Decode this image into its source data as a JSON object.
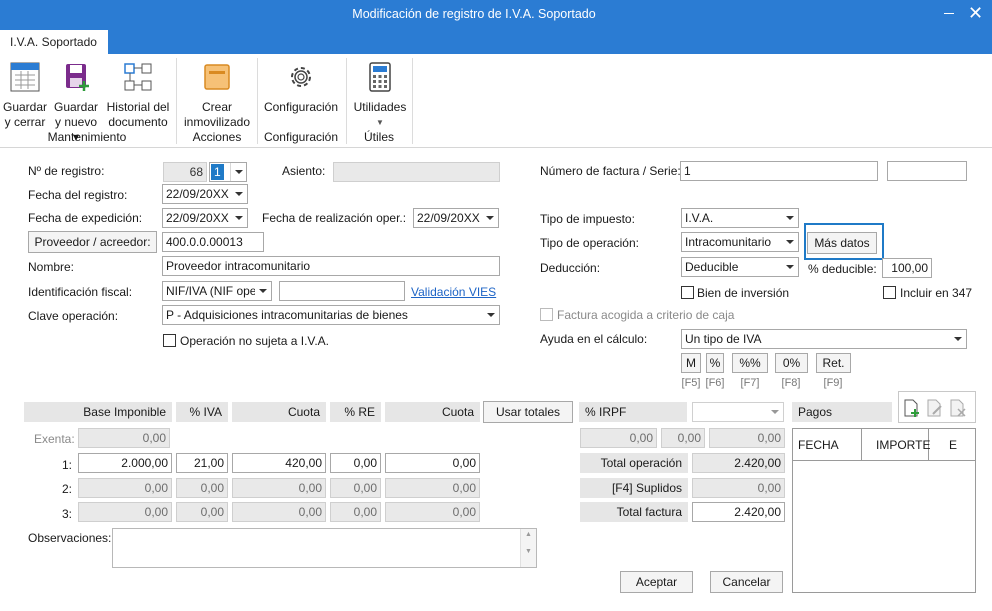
{
  "window": {
    "title": "Modificación de registro de I.V.A. Soportado"
  },
  "tab": {
    "label": "I.V.A. Soportado"
  },
  "ribbon": {
    "guardar_cerrar": [
      "Guardar",
      "y cerrar"
    ],
    "guardar_nuevo": [
      "Guardar",
      "y nuevo ▾"
    ],
    "historial": [
      "Historial del",
      "documento"
    ],
    "crear_inmovilizado": [
      "Crear",
      "inmovilizado"
    ],
    "configuracion": "Configuración",
    "utilidades": "Utilidades",
    "groups": {
      "mantenimiento": "Mantenimiento",
      "acciones": "Acciones",
      "configuracion": "Configuración",
      "utiles": "Útiles"
    }
  },
  "form": {
    "n_registro_label": "Nº de registro:",
    "n_registro_value": "68",
    "n_registro_serie": "1",
    "asiento_label": "Asiento:",
    "fecha_registro_label": "Fecha del registro:",
    "fecha_registro": "22/09/20XX",
    "fecha_expedicion_label": "Fecha de expedición:",
    "fecha_expedicion": "22/09/20XX",
    "fecha_realizacion_label": "Fecha de realización oper.:",
    "fecha_realizacion": "22/09/20XX",
    "proveedor_button": "Proveedor / acreedor:",
    "proveedor_value": "400.0.0.00013",
    "nombre_label": "Nombre:",
    "nombre_value": "Proveedor intracomunitario",
    "identificacion_label": "Identificación fiscal:",
    "identificacion_value": "NIF/IVA (NIF oper",
    "validacion_vies": "Validación VIES",
    "clave_label": "Clave operación:",
    "clave_value": "P - Adquisiciones intracomunitarias de bienes",
    "no_sujeta_label": "Operación no sujeta a I.V.A.",
    "numero_factura_label": "Número de factura / Serie:",
    "numero_factura": "1",
    "tipo_impuesto_label": "Tipo de impuesto:",
    "tipo_impuesto": "I.V.A.",
    "tipo_operacion_label": "Tipo de operación:",
    "tipo_operacion": "Intracomunitario",
    "mas_datos": "Más datos",
    "deduccion_label": "Deducción:",
    "deduccion": "Deducible",
    "pct_deducible_label": "% deducible:",
    "pct_deducible": "100,00",
    "bien_inversion": "Bien de inversión",
    "incluir_347": "Incluir en 347",
    "criterio_caja": "Factura acogida a criterio de caja",
    "ayuda_label": "Ayuda en el cálculo:",
    "ayuda_value": "Un tipo de IVA",
    "calc_buttons": [
      "M",
      "%",
      "%%",
      "0%",
      "Ret."
    ],
    "calc_keys": [
      "[F5]",
      "[F6]",
      "[F7]",
      "[F8]",
      "[F9]"
    ]
  },
  "grid": {
    "headers": {
      "base": "Base Imponible",
      "iva": "% IVA",
      "cuota": "Cuota",
      "re": "% RE",
      "cuota2": "Cuota",
      "usar_totales": "Usar totales",
      "irpf": "% IRPF"
    },
    "exenta_label": "Exenta:",
    "exenta_value": "0,00",
    "rows": [
      {
        "label": "1:",
        "base": "2.000,00",
        "iva": "21,00",
        "cuota": "420,00",
        "re": "0,00",
        "cuota2": "0,00"
      },
      {
        "label": "2:",
        "base": "0,00",
        "iva": "0,00",
        "cuota": "0,00",
        "re": "0,00",
        "cuota2": "0,00"
      },
      {
        "label": "3:",
        "base": "0,00",
        "iva": "0,00",
        "cuota": "0,00",
        "re": "0,00",
        "cuota2": "0,00"
      }
    ],
    "irpf_values": [
      "0,00",
      "0,00",
      "0,00"
    ],
    "total_operacion_label": "Total operación",
    "total_operacion": "2.420,00",
    "suplidos_label": "[F4] Suplidos",
    "suplidos": "0,00",
    "total_factura_label": "Total factura",
    "total_factura": "2.420,00"
  },
  "pagos": {
    "title": "Pagos",
    "col_fecha": "FECHA",
    "col_importe": "IMPORTE",
    "col_e": "E"
  },
  "observaciones_label": "Observaciones:",
  "buttons": {
    "aceptar": "Aceptar",
    "cancelar": "Cancelar"
  },
  "colors": {
    "accent": "#2b7cd3",
    "focus_border": "#1f7ac7",
    "link": "#1d64c6"
  }
}
